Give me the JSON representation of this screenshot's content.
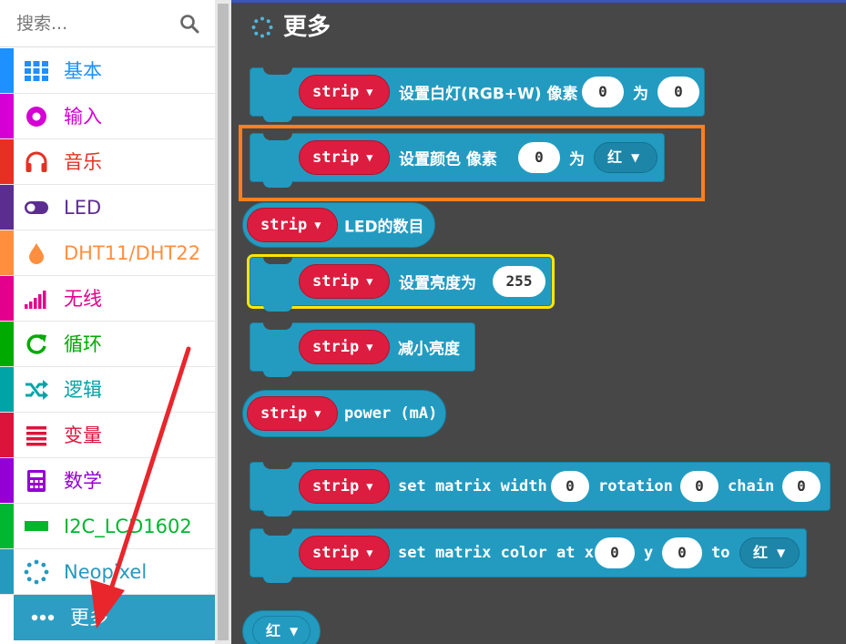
{
  "search": {
    "placeholder": "搜索..."
  },
  "categories": [
    {
      "label": "基本",
      "color": "#1e90ff",
      "icon": "grid-icon"
    },
    {
      "label": "输入",
      "color": "#d400d4",
      "icon": "radio-dot-icon"
    },
    {
      "label": "音乐",
      "color": "#e63022",
      "icon": "headphones-icon"
    },
    {
      "label": "LED",
      "color": "#5c2d91",
      "icon": "toggle-icon"
    },
    {
      "label": "DHT11/DHT22",
      "color": "#ff8f3f",
      "icon": "drop-icon"
    },
    {
      "label": "无线",
      "color": "#e3008c",
      "icon": "signal-bars-icon"
    },
    {
      "label": "循环",
      "color": "#00aa00",
      "icon": "loop-arrow-icon"
    },
    {
      "label": "逻辑",
      "color": "#00a4a6",
      "icon": "shuffle-icon"
    },
    {
      "label": "变量",
      "color": "#dc143c",
      "icon": "list-lines-icon"
    },
    {
      "label": "数学",
      "color": "#9400d3",
      "icon": "calculator-icon"
    },
    {
      "label": "I2C_LCD1602",
      "color": "#00b72f",
      "icon": "lcd-rect-icon"
    },
    {
      "label": "Neopixel",
      "color": "#2699bf",
      "icon": "dotted-circle-icon"
    },
    {
      "label": "更多",
      "color": "#2d9dc4",
      "icon": "more-dots-icon"
    }
  ],
  "flyout": {
    "title": "更多",
    "blocks": [
      {
        "var": "strip",
        "t1": "设置白灯(RGB+W) 像素",
        "v1": "0",
        "t2": "为",
        "v2": "0"
      },
      {
        "var": "strip",
        "t1": "设置颜色 像素",
        "v1": "0",
        "t2": "为",
        "dd": "红"
      },
      {
        "var": "strip",
        "t1": "LED的数目"
      },
      {
        "var": "strip",
        "t1": "设置亮度为",
        "v1": "255"
      },
      {
        "var": "strip",
        "t1": "减小亮度"
      },
      {
        "var": "strip",
        "t1": "power (mA)"
      },
      {
        "var": "strip",
        "t1": "set matrix width",
        "v1": "0",
        "t2": "rotation",
        "v2": "0",
        "t3": "chain",
        "v3": "0"
      },
      {
        "var": "strip",
        "t1": "set matrix color at x",
        "v1": "0",
        "t2": "y",
        "v2": "0",
        "t3": "to",
        "dd": "红"
      },
      {
        "dd": "红"
      }
    ]
  },
  "colors": {
    "flyout_bg": "#474747",
    "block": "#239bc1",
    "variable_pill": "#dc1d3f",
    "highlight_orange": "#ff7f1f",
    "highlight_yellow": "#ffe600",
    "arrow": "#e8262c"
  }
}
